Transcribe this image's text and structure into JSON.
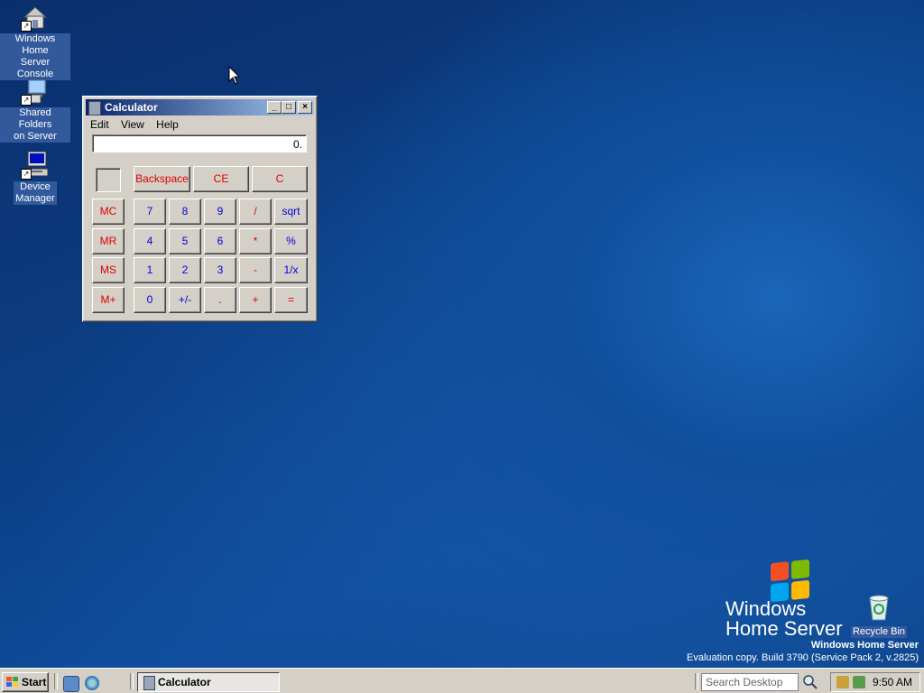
{
  "desktop": {
    "icons": [
      {
        "label_line1": "Windows Home",
        "label_line2": "Server Console",
        "icon": "home-server-icon"
      },
      {
        "label_line1": "Shared Folders",
        "label_line2": "on Server",
        "icon": "shared-folders-icon"
      },
      {
        "label_line1": "Device",
        "label_line2": "Manager",
        "icon": "device-manager-icon"
      }
    ],
    "recycle_bin": "Recycle Bin",
    "brand": {
      "line1": "Windows",
      "line2": "Home Server"
    },
    "eval_title": "Windows Home Server",
    "eval_text": "Evaluation copy. Build 3790 (Service Pack 2, v.2825)"
  },
  "calculator": {
    "title": "Calculator",
    "titlebar_buttons": {
      "minimize": "_",
      "maximize": "□",
      "close": "×"
    },
    "menu": [
      "Edit",
      "View",
      "Help"
    ],
    "display": "0.",
    "top_buttons": [
      "Backspace",
      "CE",
      "C"
    ],
    "memory_buttons": [
      "MC",
      "MR",
      "MS",
      "M+"
    ],
    "rows": [
      [
        "7",
        "8",
        "9",
        "/",
        "sqrt"
      ],
      [
        "4",
        "5",
        "6",
        "*",
        "%"
      ],
      [
        "1",
        "2",
        "3",
        "-",
        "1/x"
      ],
      [
        "0",
        "+/-",
        ".",
        "+",
        "="
      ]
    ]
  },
  "taskbar": {
    "start_label": "Start",
    "task_label": "Calculator",
    "search_placeholder": "Search Desktop",
    "clock": "9:50 AM"
  }
}
